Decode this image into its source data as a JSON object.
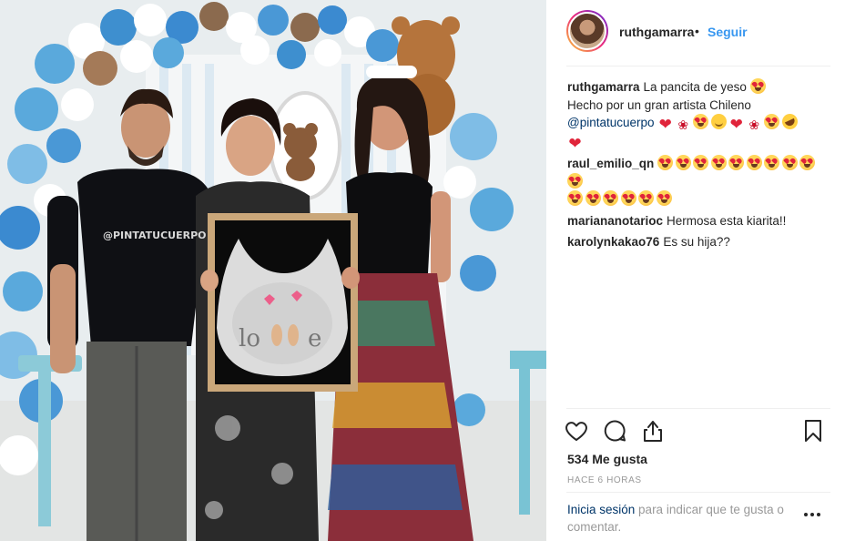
{
  "post": {
    "username": "ruthgamarra",
    "separator": "•",
    "follow_label": "Seguir"
  },
  "comments": [
    {
      "user": "ruthgamarra",
      "lines": [
        "La pancita de yeso",
        "Hecho por un gran artista Chileno"
      ],
      "mention": "@pintatucuerpo",
      "emojis_line1": [
        "heart-eyes-emoji"
      ],
      "emojis_line3": [
        "red-heart-emoji",
        "dancer-emoji",
        "heart-eyes-emoji",
        "hugging-emoji",
        "red-heart-emoji",
        "dancer-emoji",
        "heart-eyes-emoji",
        "rofl-emoji",
        "red-heart-emoji"
      ]
    },
    {
      "user": "raul_emilio_qn",
      "emojis": [
        "heart-eyes-emoji",
        "heart-eyes-emoji",
        "heart-eyes-emoji",
        "heart-eyes-emoji",
        "heart-eyes-emoji",
        "heart-eyes-emoji",
        "heart-eyes-emoji",
        "heart-eyes-emoji",
        "heart-eyes-emoji",
        "heart-eyes-emoji",
        "heart-eyes-emoji",
        "heart-eyes-emoji",
        "heart-eyes-emoji",
        "heart-eyes-emoji",
        "heart-eyes-emoji",
        "heart-eyes-emoji"
      ]
    },
    {
      "user": "mariananotarioc",
      "text": "Hermosa esta kiarita!!"
    },
    {
      "user": "karolynkakao76",
      "text": "Es su hija??"
    }
  ],
  "actions": {
    "like_icon": "heart-outline-icon",
    "comment_icon": "comment-bubble-icon",
    "share_icon": "share-upload-icon",
    "save_icon": "bookmark-icon"
  },
  "likes": "534 Me gusta",
  "timestamp": "HACE 6 HORAS",
  "login_prompt": {
    "link": "Inicia sesión",
    "text": " para indicar que te gusta o comentar."
  },
  "photo": {
    "shirt_text": "@PINTATUCUERPO",
    "cast_letters": [
      "lo",
      "e"
    ]
  },
  "colors": {
    "accent": "#3897f0",
    "link": "#003569",
    "muted": "#999999",
    "heart": "#e0243a"
  }
}
